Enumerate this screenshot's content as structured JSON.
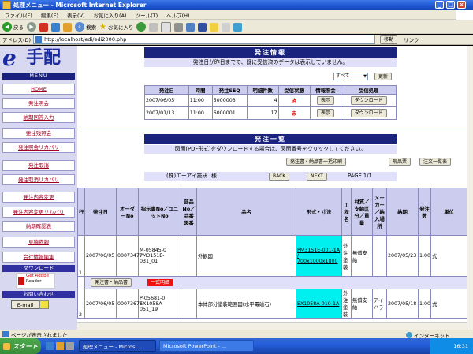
{
  "window": {
    "title": "処理メニュー - Microsoft Internet Explorer",
    "min": "_",
    "max": "□",
    "close": "×"
  },
  "menubar": [
    "ファイル(F)",
    "編集(E)",
    "表示(V)",
    "お気に入り(A)",
    "ツール(T)",
    "ヘルプ(H)"
  ],
  "toolbar": {
    "back": "戻る",
    "search": "検索",
    "favorites": "お気に入り"
  },
  "address": {
    "label": "アドレス(D)",
    "url": "http://localhost/edi/edi2000.php",
    "go": "移動",
    "links": "リンク"
  },
  "sidebar": {
    "logo_e": "e",
    "logo_text": "手配",
    "menu_header": "MENU",
    "items": [
      "HOME",
      "発注照会",
      "納期回答入力",
      "発注残照会",
      "発注照会リカバリ",
      "発注取消",
      "発注取消リカバリ",
      "発注内容変更",
      "発注内容変更リカバリ",
      "納期確認表",
      "見積依頼",
      "会社情報編集"
    ],
    "download_header": "ダウンロード",
    "adobe_get": "Get Adobe",
    "adobe_reader": "Reader",
    "contact_header": "お問い合わせ",
    "email_label": "E-mail"
  },
  "order_info": {
    "title": "発注情報",
    "message": "発注日が昨日までで、既に受信済のデータは表示していません。",
    "filter_selected": "すべて",
    "update_button": "更新",
    "columns": [
      "発注日",
      "時間",
      "発注SEQ",
      "明細件数",
      "受信状態",
      "情報照会",
      "受信処理"
    ],
    "rows": [
      {
        "date": "2007/06/05",
        "time": "11:00",
        "seq": "5000003",
        "count": "4",
        "status": "済",
        "view": "表示",
        "download": "ダウンロード"
      },
      {
        "date": "2007/01/13",
        "time": "11:00",
        "seq": "6000001",
        "count": "17",
        "status": "未",
        "view": "表示",
        "download": "ダウンロード"
      }
    ]
  },
  "order_list": {
    "title": "発注一覧",
    "message": "図面(PDF形式)をダウンロードする場合は、図面番号をクリックしてください。",
    "print_all_button": "発注書・納品書一括印刷",
    "ticket_button": "現品票",
    "notes_button": "注文一覧表",
    "company": "(株)エーアイ技研",
    "honorific": "様",
    "back_button": "BACK",
    "next_button": "NEXT",
    "page": "PAGE 1/1",
    "columns": [
      "行",
      "発注日",
      "オーダーNo",
      "指示書No／ユニットNo",
      "部品No／品番図番",
      "品名",
      "形式・寸法",
      "工程名",
      "材質／支給区分／重量",
      "メーカー／納入場所",
      "納期",
      "発注数",
      "単位"
    ],
    "rows": [
      {
        "line": "1",
        "date": "2007/06/05",
        "order": "00073477",
        "instr": "M-05845-0",
        "unit": "PM3151E-031_01",
        "name": "外観図",
        "spec": "PM3151E-001-1A / 700x1000x1800",
        "process": "外注塗装",
        "material": "無償支給",
        "maker": "",
        "due": "2007/05/23",
        "qty": "1.00",
        "unit_of": "式"
      },
      {
        "line": "2",
        "date": "2007/06/05",
        "order": "00073671",
        "instr": "P-05681-0",
        "unit": "EX1058A-051_19",
        "name": "本体部分塗装範囲図(水平電磁石)",
        "spec": "EX1058A-010-1A",
        "process": "外注塗装",
        "material": "無償支給",
        "maker": "アイハラ",
        "due": "2007/05/18",
        "qty": "1.00",
        "unit_of": "式"
      }
    ],
    "sub_button": "発注書・納品書",
    "detail_button": "一式明細"
  },
  "status": {
    "text": "ページが表示されました",
    "zone": "インターネット"
  },
  "taskbar": {
    "start": "スタート",
    "tasks": [
      "処理メニュー - Micros...",
      "Microsoft PowerPoint - ..."
    ],
    "clock": "16:31"
  },
  "colors": {
    "navy": "#1a237e",
    "lavender": "#e0e0fa",
    "header_cell": "#ccccee",
    "highlight": "#00f0f0",
    "link_red": "#a00020"
  }
}
